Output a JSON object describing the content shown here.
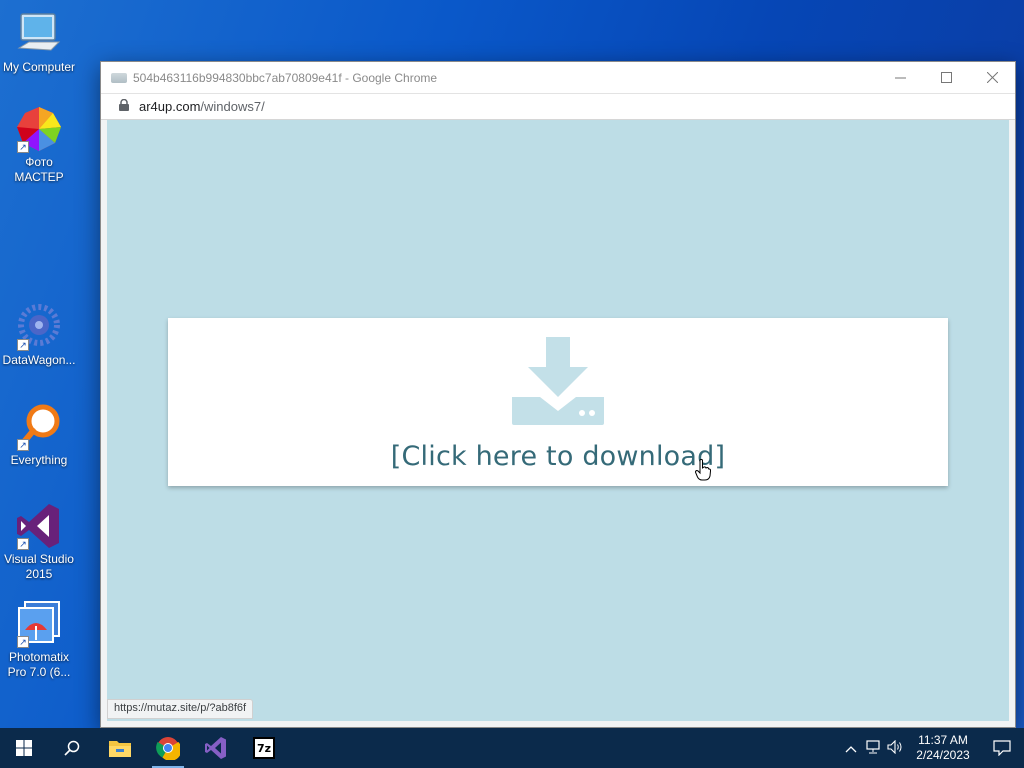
{
  "desktop": {
    "icons": [
      {
        "label": "My Computer"
      },
      {
        "label": "Фото МАСТЕР"
      },
      {
        "label": "DataWagon..."
      },
      {
        "label": "Everything"
      },
      {
        "label": "Visual Studio 2015"
      },
      {
        "label": "Photomatix Pro 7.0 (6..."
      }
    ]
  },
  "browser": {
    "title": "504b463116b994830bbc7ab70809e41f - Google Chrome",
    "url_domain": "ar4up.com",
    "url_path": "/windows7/",
    "download_text": "[Click here to download]",
    "status_url": "https://mutaz.site/p/?ab8f6f"
  },
  "taskbar": {
    "apps": [
      {
        "icon": "file-explorer-icon"
      },
      {
        "icon": "chrome-icon",
        "active": true
      },
      {
        "icon": "visual-studio-icon"
      },
      {
        "icon": "7zip-icon",
        "label": "7z"
      }
    ],
    "time": "11:37 AM",
    "date": "2/24/2023"
  },
  "colors": {
    "page_bg": "#bddde6",
    "link": "#356a78",
    "download_icon": "#c3e0e8"
  }
}
